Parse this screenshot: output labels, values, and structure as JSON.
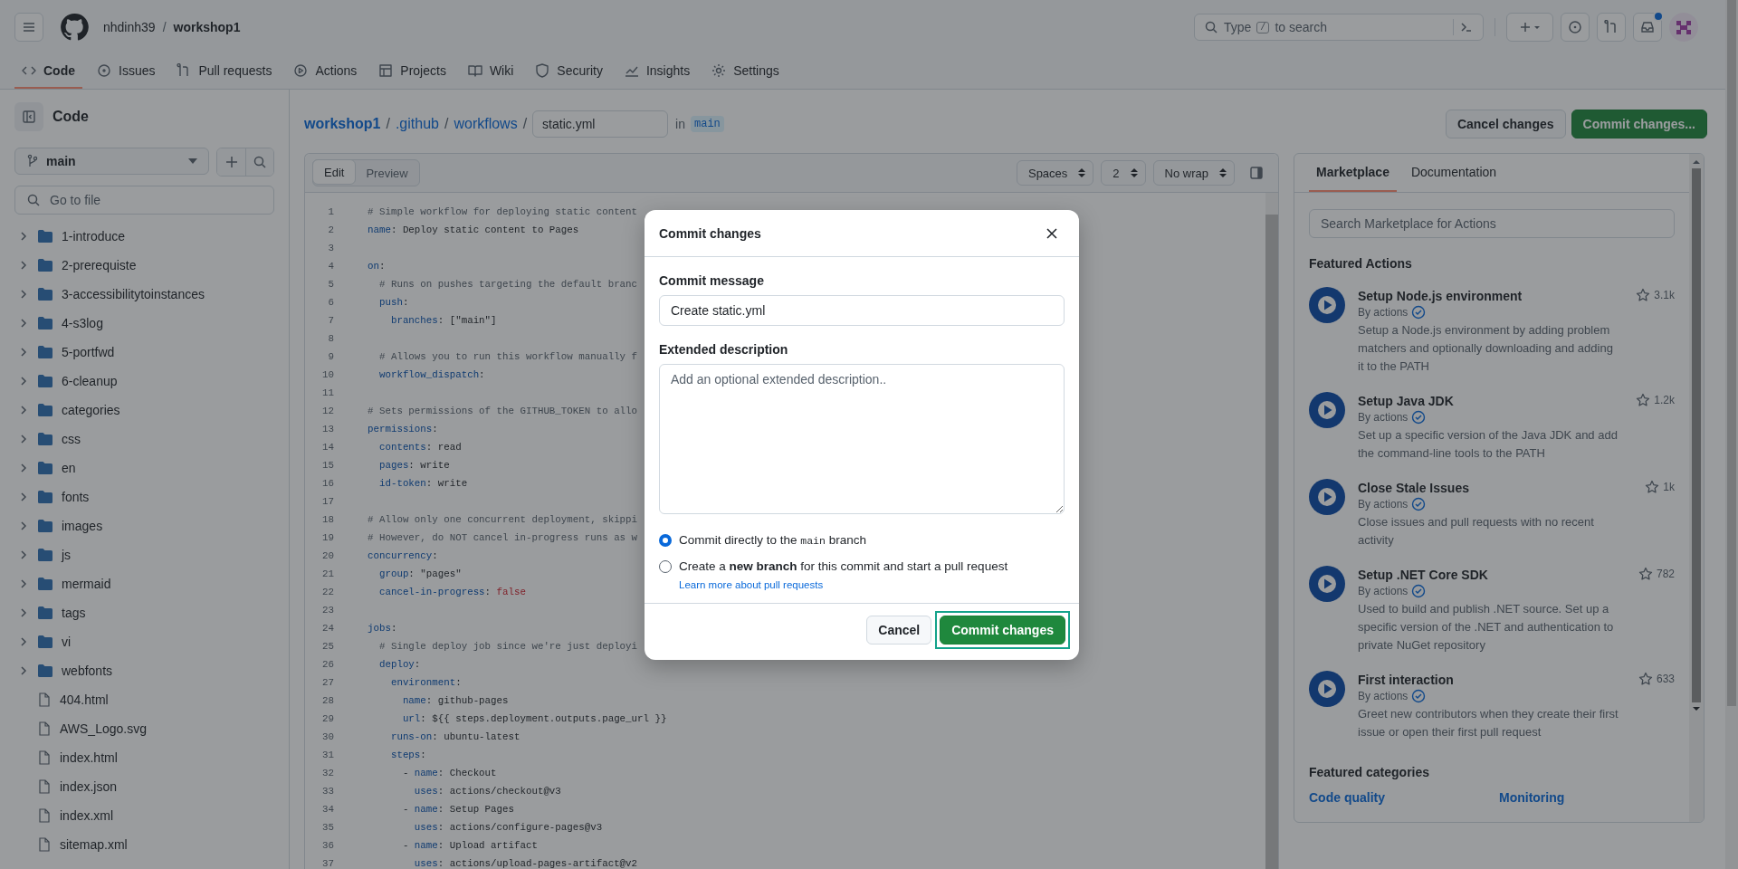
{
  "header": {
    "owner": "nhdinh39",
    "separator": "/",
    "repo": "workshop1",
    "search": {
      "text": "Type",
      "key": "/",
      "text_after": "to search"
    },
    "notifications_unread": true
  },
  "nav_tabs": [
    {
      "label": "Code",
      "selected": true
    },
    {
      "label": "Issues",
      "selected": false
    },
    {
      "label": "Pull requests",
      "selected": false
    },
    {
      "label": "Actions",
      "selected": false
    },
    {
      "label": "Projects",
      "selected": false
    },
    {
      "label": "Wiki",
      "selected": false
    },
    {
      "label": "Security",
      "selected": false
    },
    {
      "label": "Insights",
      "selected": false
    },
    {
      "label": "Settings",
      "selected": false
    }
  ],
  "sidebar": {
    "title": "Code",
    "branch": "main",
    "search_placeholder": "Go to file",
    "items": [
      {
        "name": "1-introduce",
        "kind": "folder",
        "expanded": false
      },
      {
        "name": "2-prerequiste",
        "kind": "folder",
        "expanded": false
      },
      {
        "name": "3-accessibilitytoinstances",
        "kind": "folder",
        "expanded": false
      },
      {
        "name": "4-s3log",
        "kind": "folder",
        "expanded": false
      },
      {
        "name": "5-portfwd",
        "kind": "folder",
        "expanded": false
      },
      {
        "name": "6-cleanup",
        "kind": "folder",
        "expanded": false
      },
      {
        "name": "categories",
        "kind": "folder",
        "expanded": false
      },
      {
        "name": "css",
        "kind": "folder",
        "expanded": false
      },
      {
        "name": "en",
        "kind": "folder",
        "expanded": false
      },
      {
        "name": "fonts",
        "kind": "folder",
        "expanded": false
      },
      {
        "name": "images",
        "kind": "folder",
        "expanded": false
      },
      {
        "name": "js",
        "kind": "folder",
        "expanded": false
      },
      {
        "name": "mermaid",
        "kind": "folder",
        "expanded": false
      },
      {
        "name": "tags",
        "kind": "folder",
        "expanded": false
      },
      {
        "name": "vi",
        "kind": "folder",
        "expanded": false
      },
      {
        "name": "webfonts",
        "kind": "folder",
        "expanded": false
      },
      {
        "name": "404.html",
        "kind": "file"
      },
      {
        "name": "AWS_Logo.svg",
        "kind": "file"
      },
      {
        "name": "index.html",
        "kind": "file"
      },
      {
        "name": "index.json",
        "kind": "file"
      },
      {
        "name": "index.xml",
        "kind": "file"
      },
      {
        "name": "sitemap.xml",
        "kind": "file"
      }
    ]
  },
  "breadcrumb": {
    "parts": [
      "workshop1",
      ".github",
      "workflows"
    ],
    "separator": "/",
    "filename": "static.yml",
    "in_label": "in",
    "branch": "main"
  },
  "actions": {
    "cancel": "Cancel changes",
    "commit": "Commit changes..."
  },
  "editor": {
    "tabs": [
      {
        "label": "Edit",
        "selected": true
      },
      {
        "label": "Preview",
        "selected": false
      }
    ],
    "indent_mode": "Spaces",
    "indent_size": "2",
    "wrap_mode": "No wrap",
    "lines": [
      {
        "n": "1",
        "parts": [
          {
            "kind": "comment",
            "text": "# Simple workflow for deploying static content"
          }
        ]
      },
      {
        "n": "2",
        "parts": [
          {
            "kind": "key",
            "text": "name"
          },
          {
            "kind": "plain",
            "text": ": Deploy static content to Pages"
          }
        ]
      },
      {
        "n": "3"
      },
      {
        "n": "4",
        "parts": [
          {
            "kind": "key",
            "text": "on"
          },
          {
            "kind": "plain",
            "text": ":"
          }
        ]
      },
      {
        "n": "5",
        "parts": [
          {
            "kind": "comment",
            "text": "  # Runs on pushes targeting the default branc"
          }
        ]
      },
      {
        "n": "6",
        "parts": [
          {
            "kind": "key",
            "text": "  push"
          },
          {
            "kind": "plain",
            "text": ":"
          }
        ]
      },
      {
        "n": "7",
        "parts": [
          {
            "kind": "key",
            "text": "    branches"
          },
          {
            "kind": "plain",
            "text": ": [\"main\"]"
          }
        ]
      },
      {
        "n": "8"
      },
      {
        "n": "9",
        "parts": [
          {
            "kind": "comment",
            "text": "  # Allows you to run this workflow manually f"
          }
        ]
      },
      {
        "n": "10",
        "parts": [
          {
            "kind": "key",
            "text": "  workflow_dispatch"
          },
          {
            "kind": "plain",
            "text": ":"
          }
        ]
      },
      {
        "n": "11"
      },
      {
        "n": "12",
        "parts": [
          {
            "kind": "comment",
            "text": "# Sets permissions of the GITHUB_TOKEN to allo"
          }
        ]
      },
      {
        "n": "13",
        "parts": [
          {
            "kind": "key",
            "text": "permissions"
          },
          {
            "kind": "plain",
            "text": ":"
          }
        ]
      },
      {
        "n": "14",
        "parts": [
          {
            "kind": "key",
            "text": "  contents"
          },
          {
            "kind": "plain",
            "text": ": read"
          }
        ]
      },
      {
        "n": "15",
        "parts": [
          {
            "kind": "key",
            "text": "  pages"
          },
          {
            "kind": "plain",
            "text": ": write"
          }
        ]
      },
      {
        "n": "16",
        "parts": [
          {
            "kind": "key",
            "text": "  id-token"
          },
          {
            "kind": "plain",
            "text": ": write"
          }
        ]
      },
      {
        "n": "17"
      },
      {
        "n": "18",
        "parts": [
          {
            "kind": "comment",
            "text": "# Allow only one concurrent deployment, skippi"
          }
        ]
      },
      {
        "n": "19",
        "parts": [
          {
            "kind": "comment",
            "text": "# However, do NOT cancel in-progress runs as w"
          }
        ]
      },
      {
        "n": "20",
        "parts": [
          {
            "kind": "key",
            "text": "concurrency"
          },
          {
            "kind": "plain",
            "text": ":"
          }
        ]
      },
      {
        "n": "21",
        "parts": [
          {
            "kind": "key",
            "text": "  group"
          },
          {
            "kind": "plain",
            "text": ": \"pages\""
          }
        ]
      },
      {
        "n": "22",
        "parts": [
          {
            "kind": "key",
            "text": "  cancel-in-progress"
          },
          {
            "kind": "plain",
            "text": ": "
          },
          {
            "kind": "bool",
            "text": "false"
          }
        ]
      },
      {
        "n": "23"
      },
      {
        "n": "24",
        "parts": [
          {
            "kind": "key",
            "text": "jobs"
          },
          {
            "kind": "plain",
            "text": ":"
          }
        ]
      },
      {
        "n": "25",
        "parts": [
          {
            "kind": "comment",
            "text": "  # Single deploy job since we're just deployi"
          }
        ]
      },
      {
        "n": "26",
        "parts": [
          {
            "kind": "key",
            "text": "  deploy"
          },
          {
            "kind": "plain",
            "text": ":"
          }
        ]
      },
      {
        "n": "27",
        "parts": [
          {
            "kind": "key",
            "text": "    environment"
          },
          {
            "kind": "plain",
            "text": ":"
          }
        ]
      },
      {
        "n": "28",
        "parts": [
          {
            "kind": "key",
            "text": "      name"
          },
          {
            "kind": "plain",
            "text": ": github-pages"
          }
        ]
      },
      {
        "n": "29",
        "parts": [
          {
            "kind": "key",
            "text": "      url"
          },
          {
            "kind": "plain",
            "text": ": ${{ steps.deployment.outputs.page_url }}"
          }
        ]
      },
      {
        "n": "30",
        "parts": [
          {
            "kind": "key",
            "text": "    runs-on"
          },
          {
            "kind": "plain",
            "text": ": ubuntu-latest"
          }
        ]
      },
      {
        "n": "31",
        "parts": [
          {
            "kind": "key",
            "text": "    steps"
          },
          {
            "kind": "plain",
            "text": ":"
          }
        ]
      },
      {
        "n": "32",
        "parts": [
          {
            "kind": "plain",
            "text": "      - "
          },
          {
            "kind": "key",
            "text": "name"
          },
          {
            "kind": "plain",
            "text": ": Checkout"
          }
        ]
      },
      {
        "n": "33",
        "parts": [
          {
            "kind": "key",
            "text": "        uses"
          },
          {
            "kind": "plain",
            "text": ": actions/checkout@v3"
          }
        ]
      },
      {
        "n": "34",
        "parts": [
          {
            "kind": "plain",
            "text": "      - "
          },
          {
            "kind": "key",
            "text": "name"
          },
          {
            "kind": "plain",
            "text": ": Setup Pages"
          }
        ]
      },
      {
        "n": "35",
        "parts": [
          {
            "kind": "key",
            "text": "        uses"
          },
          {
            "kind": "plain",
            "text": ": actions/configure-pages@v3"
          }
        ]
      },
      {
        "n": "36",
        "parts": [
          {
            "kind": "plain",
            "text": "      - "
          },
          {
            "kind": "key",
            "text": "name"
          },
          {
            "kind": "plain",
            "text": ": Upload artifact"
          }
        ]
      },
      {
        "n": "37",
        "parts": [
          {
            "kind": "key",
            "text": "        uses"
          },
          {
            "kind": "plain",
            "text": ": actions/upload-pages-artifact@v2"
          }
        ]
      }
    ]
  },
  "side_panel": {
    "tabs": [
      {
        "label": "Marketplace",
        "selected": true
      },
      {
        "label": "Documentation",
        "selected": false
      }
    ],
    "search_placeholder": "Search Marketplace for Actions",
    "featured_title": "Featured Actions",
    "featured_actions": [
      {
        "title": "Setup Node.js environment",
        "by": "By actions",
        "stars": "3.1k",
        "description": "Setup a Node.js environment by adding problem matchers and optionally downloading and adding it to the PATH"
      },
      {
        "title": "Setup Java JDK",
        "by": "By actions",
        "stars": "1.2k",
        "description": "Set up a specific version of the Java JDK and add the command-line tools to the PATH"
      },
      {
        "title": "Close Stale Issues",
        "by": "By actions",
        "stars": "1k",
        "description": "Close issues and pull requests with no recent activity"
      },
      {
        "title": "Setup .NET Core SDK",
        "by": "By actions",
        "stars": "782",
        "description": "Used to build and publish .NET source. Set up a specific version of the .NET and authentication to private NuGet repository"
      },
      {
        "title": "First interaction",
        "by": "By actions",
        "stars": "633",
        "description": "Greet new contributors when they create their first issue or open their first pull request"
      }
    ],
    "categories_title": "Featured categories",
    "categories": [
      "Code quality",
      "Monitoring"
    ]
  },
  "dialog": {
    "title": "Commit changes",
    "message_label": "Commit message",
    "message_value": "Create static.yml",
    "description_label": "Extended description",
    "description_placeholder": "Add an optional extended description..",
    "options": [
      {
        "label": "Commit directly to the",
        "code": "main",
        "label_after": "branch",
        "selected": true
      },
      {
        "label": "Create a **new branch** for this commit and start a pull request",
        "selected": false
      }
    ],
    "learn_more": "Learn more about pull requests",
    "cancel": "Cancel",
    "submit": "Commit changes",
    "submit_highlighted": true
  }
}
